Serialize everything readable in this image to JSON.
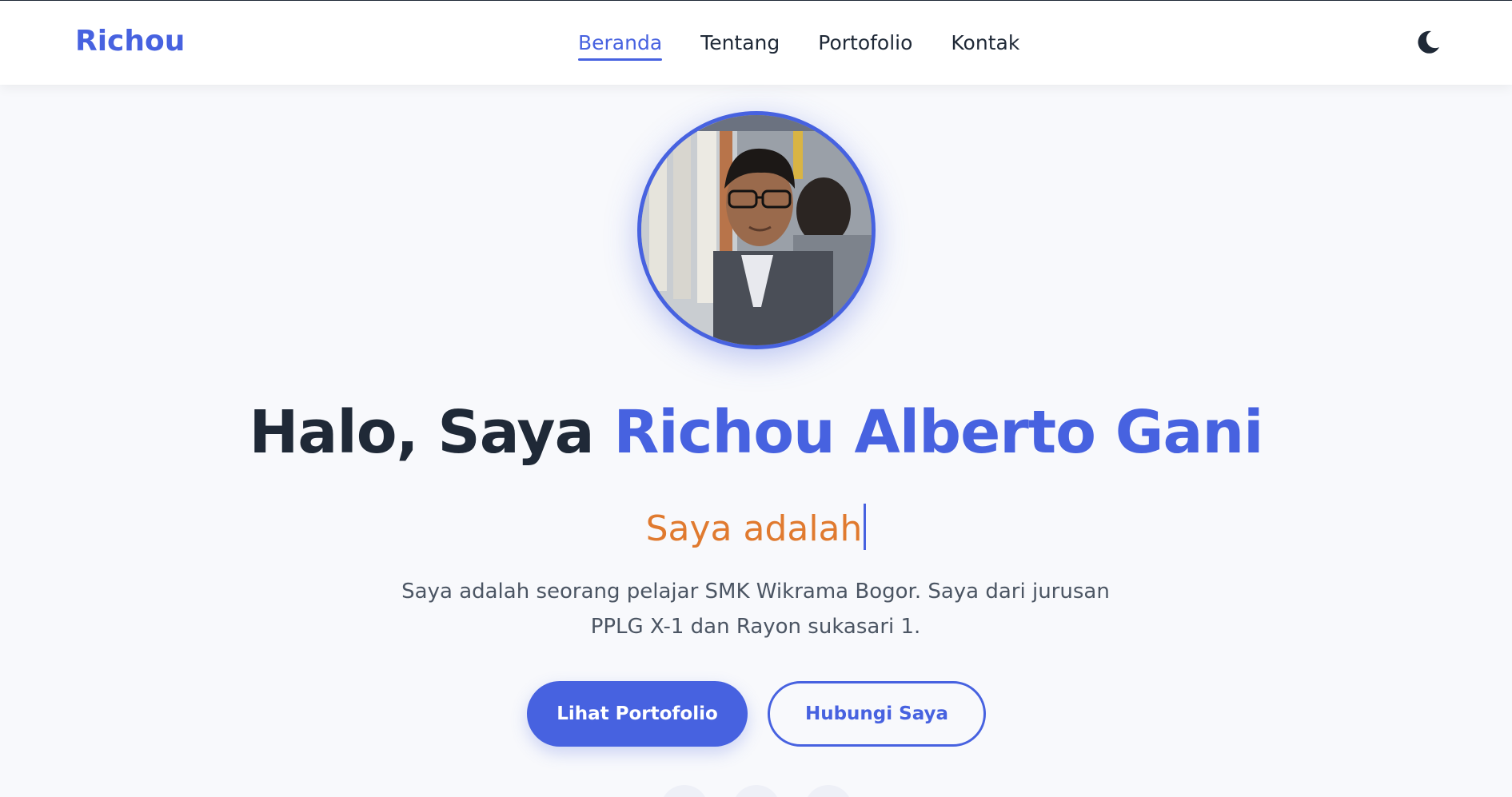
{
  "brand": {
    "name": "Richou",
    "accent_color": "#4762e0",
    "secondary_color": "#e07a2f"
  },
  "nav": {
    "items": [
      {
        "label": "Beranda",
        "active": true
      },
      {
        "label": "Tentang",
        "active": false
      },
      {
        "label": "Portofolio",
        "active": false
      },
      {
        "label": "Kontak",
        "active": false
      }
    ],
    "theme_toggle_icon": "moon-icon"
  },
  "hero": {
    "greeting": "Halo, Saya",
    "name": "Richou Alberto Gani",
    "typing_text": "Saya adalah",
    "description": "Saya adalah seorang pelajar SMK Wikrama Bogor. Saya dari jurusan PPLG X-1 dan Rayon sukasari 1.",
    "primary_button": "Lihat Portofolio",
    "secondary_button": "Hubungi Saya",
    "avatar_alt": "profile-photo"
  }
}
